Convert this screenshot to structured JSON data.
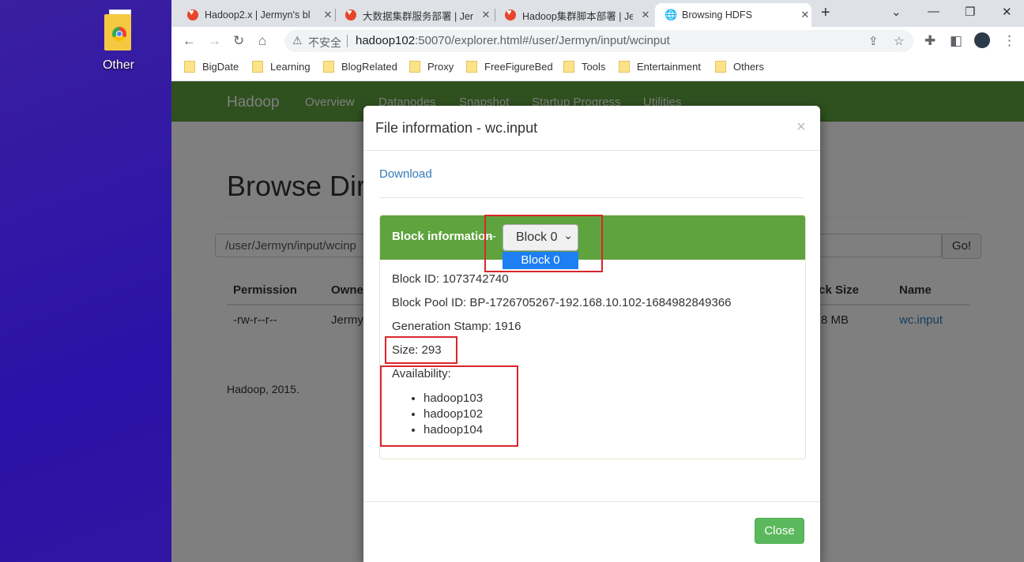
{
  "desktop": {
    "icon_label": "Other"
  },
  "browser": {
    "tabs": [
      {
        "title": "Hadoop2.x | Jermyn's bl",
        "icon": "heart-favicon-icon"
      },
      {
        "title": "大数据集群服务部署 | Jer",
        "icon": "heart-favicon-icon"
      },
      {
        "title": "Hadoop集群脚本部署 | Je",
        "icon": "heart-favicon-icon"
      },
      {
        "title": "Browsing HDFS",
        "icon": "globe-icon",
        "active": true
      }
    ],
    "address": {
      "security_text": "不安全",
      "url_host": "hadoop102",
      "url_rest": ":50070/explorer.html#/user/Jermyn/input/wcinput"
    },
    "bookmarks": [
      "BigDate",
      "Learning",
      "BlogRelated",
      "Proxy",
      "FreeFigureBed",
      "Tools",
      "Entertainment",
      "Others"
    ]
  },
  "page": {
    "brand": "Hadoop",
    "nav": [
      "Overview",
      "Datanodes",
      "Snapshot",
      "Startup Progress",
      "Utilities"
    ],
    "heading": "Browse Dir",
    "path_value": "/user/Jermyn/input/wcinp",
    "go_label": "Go!",
    "table": {
      "headers": [
        "Permission",
        "Owne",
        "ock Size",
        "Name"
      ],
      "row": {
        "permission": "-rw-r--r--",
        "owner": "Jermy",
        "block_size": "8 MB",
        "name": "wc.input"
      }
    },
    "footer": "Hadoop, 2015."
  },
  "modal": {
    "title": "File information - wc.input",
    "close_glyph": "×",
    "download_label": "Download",
    "block_info_label": "Block information",
    "dash": "--",
    "selected_block": "Block 0",
    "dropdown_options": [
      "Block 0"
    ],
    "block_id": "Block ID: 1073742740",
    "block_pool_id": "Block Pool ID: BP-1726705267-192.168.10.102-1684982849366",
    "generation_stamp": "Generation Stamp: 1916",
    "size": "Size: 293",
    "availability_label": "Availability:",
    "availability": [
      "hadoop103",
      "hadoop102",
      "hadoop104"
    ],
    "close_button": "Close"
  },
  "colors": {
    "hadoop_green": "#5fa33e",
    "highlight_red": "#d9262c",
    "select_blue": "#1e7ff2"
  }
}
